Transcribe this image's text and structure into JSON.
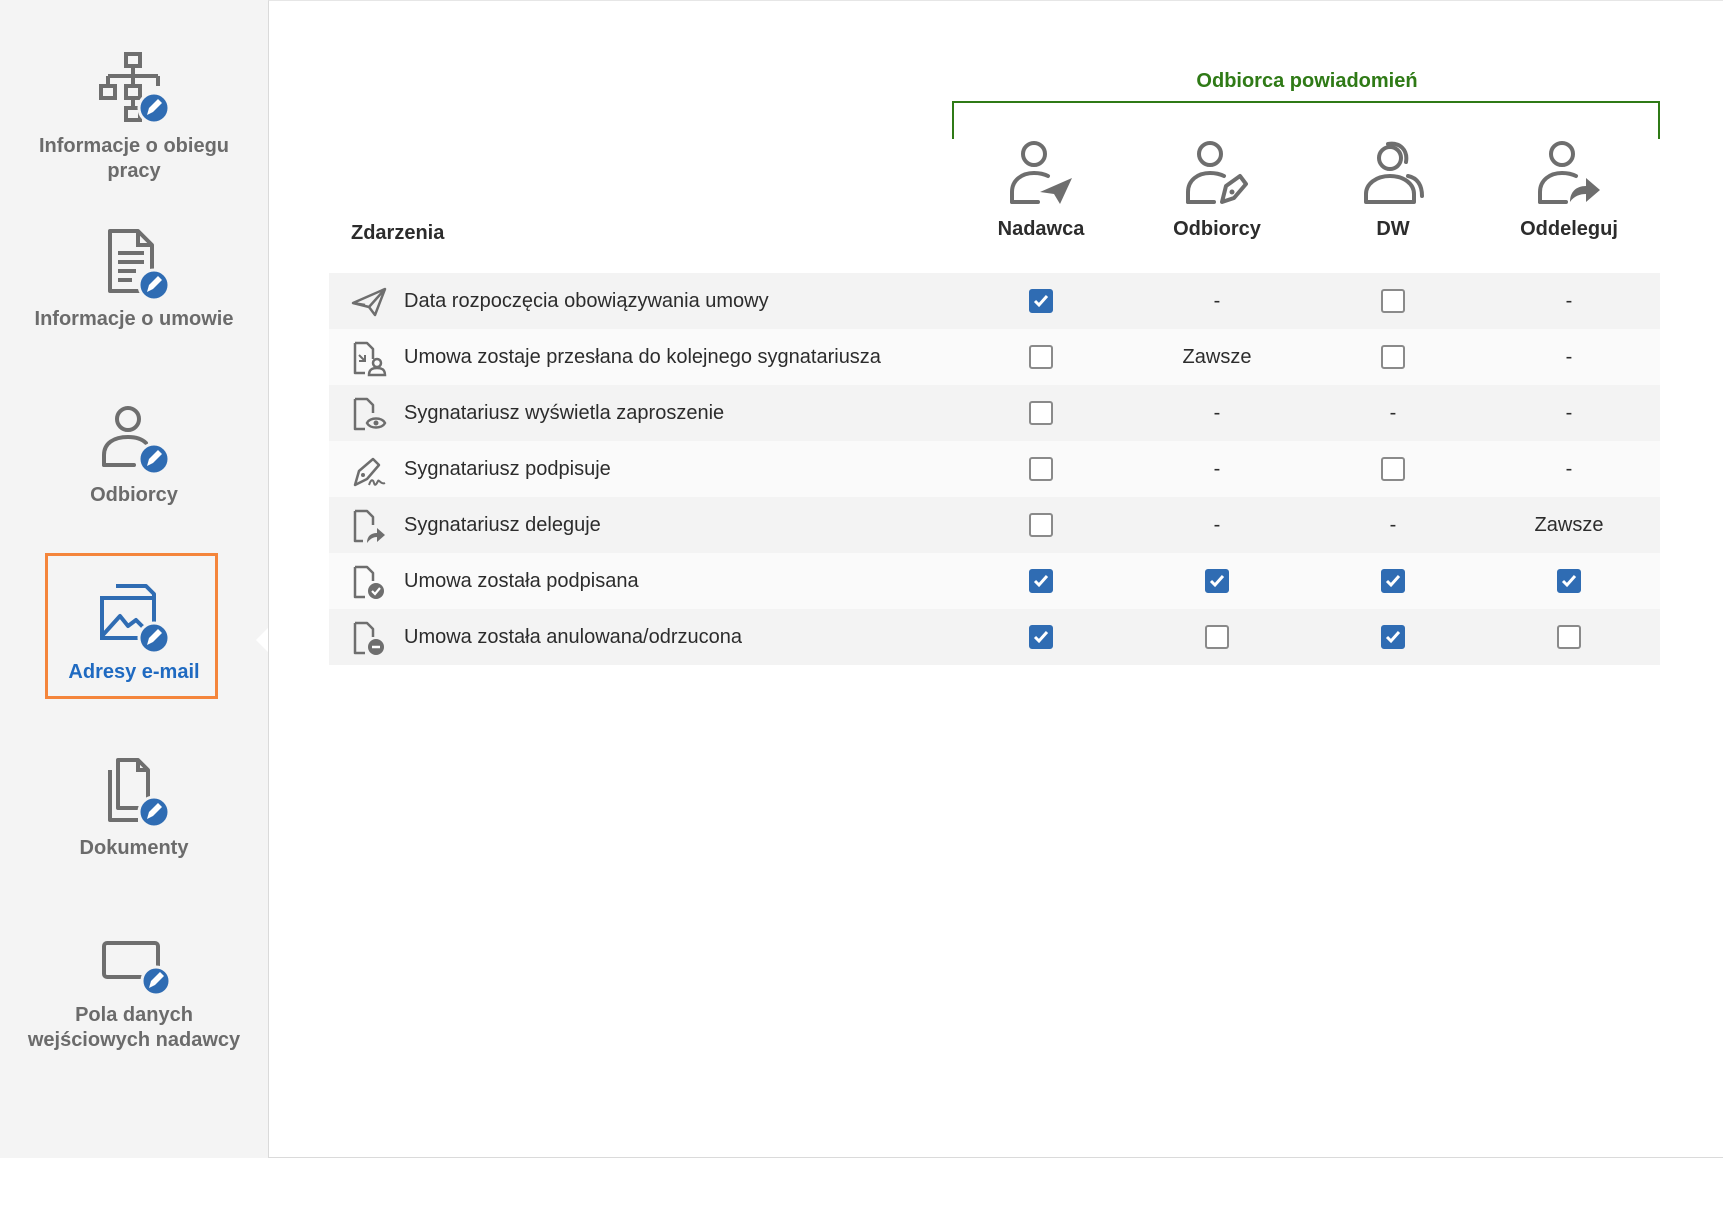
{
  "sidebar": {
    "items": [
      {
        "label": "Informacje o obiegu\npracy",
        "icon": "workflow-edit-icon",
        "active": false
      },
      {
        "label": "Informacje o umowie",
        "icon": "document-edit-icon",
        "active": false
      },
      {
        "label": "Odbiorcy",
        "icon": "recipient-edit-icon",
        "active": false
      },
      {
        "label": "Adresy e-mail",
        "icon": "email-edit-icon",
        "active": true
      },
      {
        "label": "Dokumenty",
        "icon": "documents-edit-icon",
        "active": false
      },
      {
        "label": "Pola danych\nwejściowych nadawcy",
        "icon": "input-field-edit-icon",
        "active": false
      }
    ]
  },
  "table": {
    "group_title": "Odbiorca powiadomień",
    "events_header": "Zdarzenia",
    "columns": [
      {
        "label": "Nadawca",
        "icon": "sender-icon"
      },
      {
        "label": "Odbiorcy",
        "icon": "recipients-icon"
      },
      {
        "label": "DW",
        "icon": "cc-icon"
      },
      {
        "label": "Oddeleguj",
        "icon": "delegate-icon"
      }
    ],
    "rows": [
      {
        "label": "Data rozpoczęcia obowiązywania umowy",
        "icon": "paper-plane-icon",
        "cells": [
          {
            "type": "checkbox",
            "checked": true
          },
          {
            "type": "text",
            "value": "-"
          },
          {
            "type": "checkbox",
            "checked": false
          },
          {
            "type": "text",
            "value": "-"
          }
        ]
      },
      {
        "label": "Umowa zostaje przesłana do kolejnego sygnatariusza",
        "icon": "document-forward-icon",
        "cells": [
          {
            "type": "checkbox",
            "checked": false
          },
          {
            "type": "text",
            "value": "Zawsze"
          },
          {
            "type": "checkbox",
            "checked": false
          },
          {
            "type": "text",
            "value": "-"
          }
        ]
      },
      {
        "label": "Sygnatariusz wyświetla zaproszenie",
        "icon": "document-view-icon",
        "cells": [
          {
            "type": "checkbox",
            "checked": false
          },
          {
            "type": "text",
            "value": "-"
          },
          {
            "type": "text",
            "value": "-"
          },
          {
            "type": "text",
            "value": "-"
          }
        ]
      },
      {
        "label": "Sygnatariusz podpisuje",
        "icon": "pen-sign-icon",
        "cells": [
          {
            "type": "checkbox",
            "checked": false
          },
          {
            "type": "text",
            "value": "-"
          },
          {
            "type": "checkbox",
            "checked": false
          },
          {
            "type": "text",
            "value": "-"
          }
        ]
      },
      {
        "label": "Sygnatariusz deleguje",
        "icon": "document-delegate-icon",
        "cells": [
          {
            "type": "checkbox",
            "checked": false
          },
          {
            "type": "text",
            "value": "-"
          },
          {
            "type": "text",
            "value": "-"
          },
          {
            "type": "text",
            "value": "Zawsze"
          }
        ]
      },
      {
        "label": "Umowa została podpisana",
        "icon": "document-check-icon",
        "cells": [
          {
            "type": "checkbox",
            "checked": true
          },
          {
            "type": "checkbox",
            "checked": true
          },
          {
            "type": "checkbox",
            "checked": true
          },
          {
            "type": "checkbox",
            "checked": true
          }
        ]
      },
      {
        "label": "Umowa została anulowana/odrzucona",
        "icon": "document-cancel-icon",
        "cells": [
          {
            "type": "checkbox",
            "checked": true
          },
          {
            "type": "checkbox",
            "checked": false
          },
          {
            "type": "checkbox",
            "checked": true
          },
          {
            "type": "checkbox",
            "checked": false
          }
        ]
      }
    ]
  },
  "colors": {
    "accent": "#2f6cb3",
    "active_border": "#f4853b",
    "group_green": "#2f7a16",
    "sidebar_bg": "#f4f4f4",
    "icon_gray": "#6e6e6e"
  }
}
